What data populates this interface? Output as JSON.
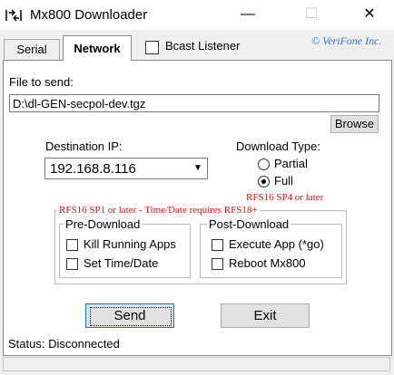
{
  "window": {
    "title": "Mx800 Downloader",
    "minimize": "—",
    "maximize": "☐",
    "close": "✕"
  },
  "tabs": [
    {
      "label": "Serial"
    },
    {
      "label": "Network"
    }
  ],
  "bcast_label": "Bcast Listener",
  "copyright": "© VeriFone Inc.",
  "file": {
    "label": "File to send:",
    "value": "D:\\dl-GEN-secpol-dev.tgz",
    "browse": "Browse"
  },
  "destination": {
    "label": "Destination IP:",
    "value": "192.168.8.116",
    "arrow_icon": "▼"
  },
  "download_type": {
    "label": "Download Type:",
    "options": [
      {
        "label": "Partial",
        "selected": false
      },
      {
        "label": "Full",
        "selected": true
      }
    ],
    "note": "RFS16 SP4 or later"
  },
  "group_note": "RFS16 SP1 or later - Time/Date requires RFS18+",
  "pre_download": {
    "title": "Pre-Download",
    "items": [
      {
        "label": "Kill Running Apps",
        "checked": false
      },
      {
        "label": "Set Time/Date",
        "checked": false
      }
    ]
  },
  "post_download": {
    "title": "Post-Download",
    "items": [
      {
        "label": "Execute App (*go)",
        "checked": false
      },
      {
        "label": "Reboot Mx800",
        "checked": false
      }
    ]
  },
  "buttons": {
    "send": "Send",
    "exit": "Exit"
  },
  "status": "Status: Disconnected",
  "colors": {
    "note_red": "#e01010",
    "copyright_blue": "#3b6fc5",
    "focus_blue": "#0078d7"
  }
}
